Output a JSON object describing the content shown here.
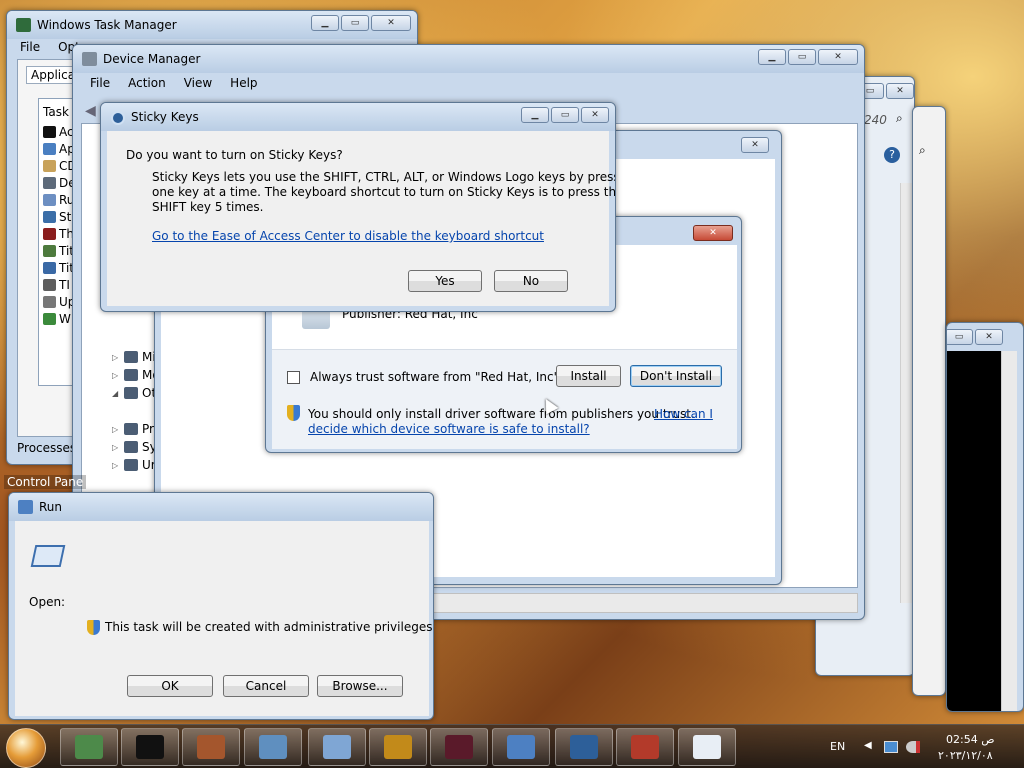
{
  "task_manager": {
    "title": "Windows Task Manager",
    "menu": [
      "File",
      "Opt"
    ],
    "tab": "Applicatio",
    "col": "Task",
    "items": [
      "Ac",
      "Ap",
      "CD",
      "De",
      "Ru",
      "St",
      "Th",
      "Tit",
      "Tit",
      "TI",
      "Up",
      "W"
    ],
    "processes": "Processes:"
  },
  "device_manager": {
    "title": "Device Manager",
    "menu": [
      "File",
      "Action",
      "View",
      "Help"
    ],
    "tree": [
      "Mi",
      "Mo",
      "Ot",
      "Pr",
      "Sy",
      "Ur"
    ]
  },
  "right_window": {
    "search": "240"
  },
  "sticky_keys": {
    "title": "Sticky Keys",
    "question": "Do you want to turn on Sticky Keys?",
    "body_line1": "Sticky Keys lets you use the SHIFT, CTRL, ALT, or Windows Logo keys by pressing",
    "body_line2": "one key at a time. The keyboard shortcut to turn on Sticky Keys is to press the",
    "body_line3": "SHIFT key 5 times.",
    "link": "Go to the Ease of Access Center to disable the keyboard shortcut",
    "yes": "Yes",
    "no": "No"
  },
  "driver_dialog": {
    "publisher": "Publisher: Red Hat, Inc",
    "always_trust": "Always trust software from \"Red Hat, Inc\".",
    "install": "Install",
    "dont_install": "Don't Install",
    "warning": "You should only install driver software from publishers you trust.",
    "link_a": "How can I",
    "link_b": "decide which device software is safe to install?"
  },
  "control_panel": {
    "title": "Control Pane"
  },
  "run_dialog": {
    "title": "Run",
    "open_label": "Open:",
    "admin_note": "This task will be created with administrative privileges.",
    "ok": "OK",
    "cancel": "Cancel",
    "browse": "Browse..."
  },
  "taskbar": {
    "lang": "EN",
    "time": "02:54 ص",
    "date": "٢٠٢٣/١٢/٠٨"
  },
  "colors": {
    "title_bar": "#c9d9ec",
    "close_red": "#c64a36",
    "link": "#0645ad"
  }
}
